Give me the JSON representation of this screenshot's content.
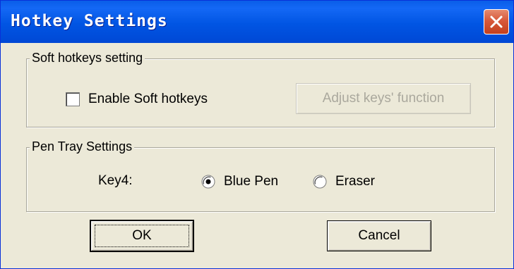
{
  "window": {
    "title": "Hotkey Settings",
    "close_icon": "close-icon",
    "accent_color": "#0155e3",
    "close_color": "#d8593b"
  },
  "soft_hotkeys": {
    "legend": "Soft hotkeys setting",
    "enable_label": "Enable Soft hotkeys",
    "enable_checked": false,
    "adjust_button_label": "Adjust keys' function",
    "adjust_button_enabled": false
  },
  "pen_tray": {
    "legend": "Pen Tray Settings",
    "key_label": "Key4:",
    "options": [
      {
        "label": "Blue Pen",
        "selected": true
      },
      {
        "label": "Eraser",
        "selected": false
      }
    ]
  },
  "buttons": {
    "ok_label": "OK",
    "cancel_label": "Cancel"
  }
}
